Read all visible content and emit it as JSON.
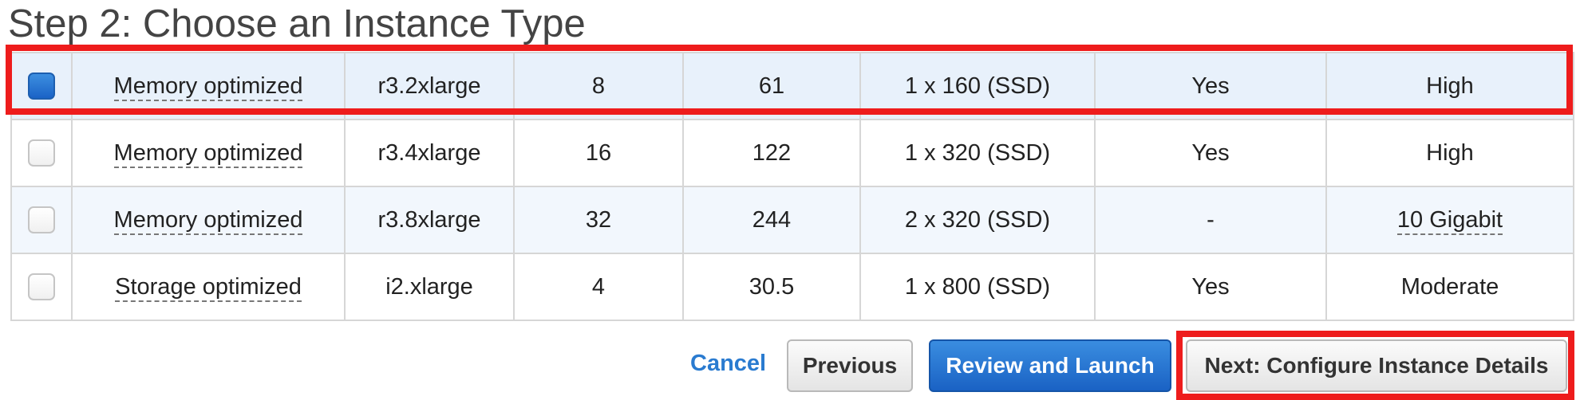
{
  "page": {
    "title": "Step 2: Choose an Instance Type"
  },
  "instances": [
    {
      "selected": true,
      "family": "Memory optimized",
      "type": "r3.2xlarge",
      "vcpus": "8",
      "memory": "61",
      "storage": "1 x 160 (SSD)",
      "ebs_optimized": "Yes",
      "network": "High"
    },
    {
      "selected": false,
      "family": "Memory optimized",
      "type": "r3.4xlarge",
      "vcpus": "16",
      "memory": "122",
      "storage": "1 x 320 (SSD)",
      "ebs_optimized": "Yes",
      "network": "High"
    },
    {
      "selected": false,
      "family": "Memory optimized",
      "type": "r3.8xlarge",
      "vcpus": "32",
      "memory": "244",
      "storage": "2 x 320 (SSD)",
      "ebs_optimized": "-",
      "network": "10 Gigabit"
    },
    {
      "selected": false,
      "family": "Storage optimized",
      "type": "i2.xlarge",
      "vcpus": "4",
      "memory": "30.5",
      "storage": "1 x 800 (SSD)",
      "ebs_optimized": "Yes",
      "network": "Moderate"
    }
  ],
  "actions": {
    "cancel": "Cancel",
    "previous": "Previous",
    "review_launch": "Review and Launch",
    "next": "Next: Configure Instance Details"
  },
  "colors": {
    "highlight": "#ee1c1c",
    "primary": "#1a62c4",
    "link": "#2a7bd0"
  }
}
